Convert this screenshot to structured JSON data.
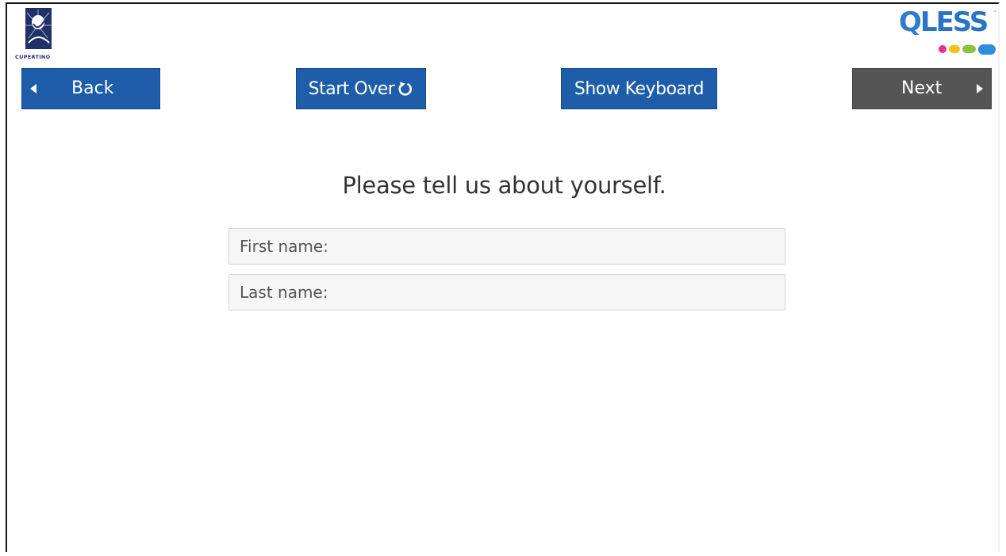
{
  "logos": {
    "city_logo_text": "CUPERTINO",
    "brand_logo_text": "LESS",
    "brand_logo_initial": "Q",
    "brand_logo_tm": "™",
    "brand_colors": [
      "#ec2d8f",
      "#f4c119",
      "#8ac43f",
      "#2c8ede"
    ]
  },
  "toolbar": {
    "back_label": "Back",
    "start_over_label": "Start Over",
    "show_keyboard_label": "Show Keyboard",
    "next_label": "Next",
    "primary_color": "#1e5da9",
    "next_color": "#555555"
  },
  "form": {
    "heading": "Please tell us about yourself.",
    "first_name": {
      "placeholder": "First name:",
      "value": ""
    },
    "last_name": {
      "placeholder": "Last name:",
      "value": ""
    }
  }
}
